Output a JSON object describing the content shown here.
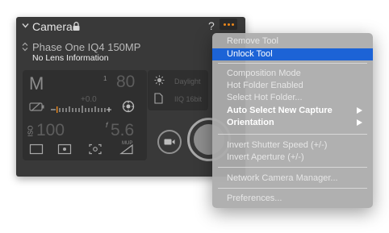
{
  "panel": {
    "title": "Camera",
    "help": "?",
    "camera_model": "Phase One IQ4 150MP",
    "lens": "No Lens Information",
    "exposure_mode": "M",
    "shutter_numerator": "1",
    "shutter_denominator": "80",
    "exposure_comp": "+0.0",
    "iso_label": "ISO",
    "iso_value": "100",
    "aperture_label": "f",
    "aperture_value": "5.6",
    "mup_label": "MUP",
    "white_balance": "Daylight",
    "file_format": "IIQ 16bit"
  },
  "colors": {
    "accent_orange": "#f08a1c",
    "menu_highlight": "#1c63d6"
  },
  "menu": {
    "remove_tool": "Remove Tool",
    "unlock_tool": "Unlock Tool",
    "composition_mode": "Composition Mode",
    "hot_folder_enabled": "Hot Folder Enabled",
    "select_hot_folder": "Select Hot Folder...",
    "auto_select_new_capture": "Auto Select New Capture",
    "orientation": "Orientation",
    "invert_shutter_speed": "Invert Shutter Speed (+/-)",
    "invert_aperture": "Invert Aperture (+/-)",
    "network_camera_manager": "Network Camera Manager...",
    "preferences": "Preferences..."
  }
}
